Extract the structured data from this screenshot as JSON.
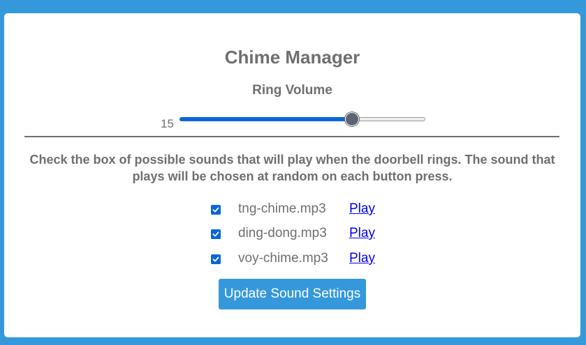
{
  "page": {
    "title": "Chime Manager"
  },
  "volume": {
    "label": "Ring Volume",
    "value": "15",
    "fraction": 0.7,
    "fill_color": "#0a66d8"
  },
  "instructions": "Check the box of possible sounds that will play when the doorbell rings. The sound that plays will be chosen at random on each button press.",
  "sounds": [
    {
      "name": "tng-chime.mp3",
      "checked": true,
      "play_label": "Play"
    },
    {
      "name": "ding-dong.mp3",
      "checked": true,
      "play_label": "Play"
    },
    {
      "name": "voy-chime.mp3",
      "checked": true,
      "play_label": "Play"
    }
  ],
  "update_button_label": "Update Sound Settings",
  "colors": {
    "background": "#3498db",
    "text": "#6f6f6f",
    "link": "#0000ee",
    "checkbox": "#0a66d8",
    "button": "#3498db"
  }
}
